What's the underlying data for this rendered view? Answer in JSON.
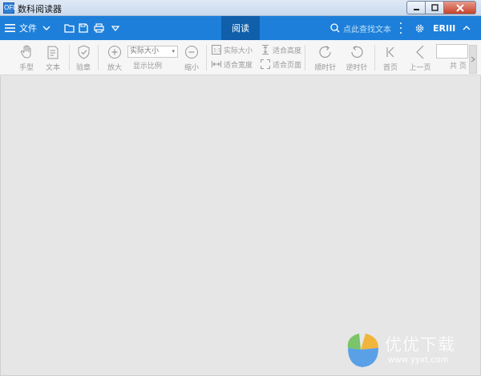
{
  "window": {
    "title": "数科阅读器",
    "app_icon": "OFD"
  },
  "menubar": {
    "file_label": "文件",
    "active_tab": "阅读",
    "search_placeholder": "点此查找文本",
    "brand": "ERIII",
    "colors": {
      "bar": "#1d7fd9",
      "active_tab": "#0f5fab"
    }
  },
  "toolbar": {
    "hand": "手型",
    "text": "文本",
    "verify": "验章",
    "zoom_in": "放大",
    "zoom_value": "实际大小",
    "zoom_label": "显示比例",
    "zoom_out": "缩小",
    "actual_size": "实际大小",
    "fit_height": "适合高度",
    "fit_width": "适合宽度",
    "fit_page": "适合页面",
    "clockwise": "顺时针",
    "counterclockwise": "逆时针",
    "first_page": "首页",
    "prev_page": "上一页",
    "page_value": "",
    "total_label": "共 页"
  },
  "watermark": {
    "brand": "优优下载",
    "url": "www.yyxt.com"
  }
}
